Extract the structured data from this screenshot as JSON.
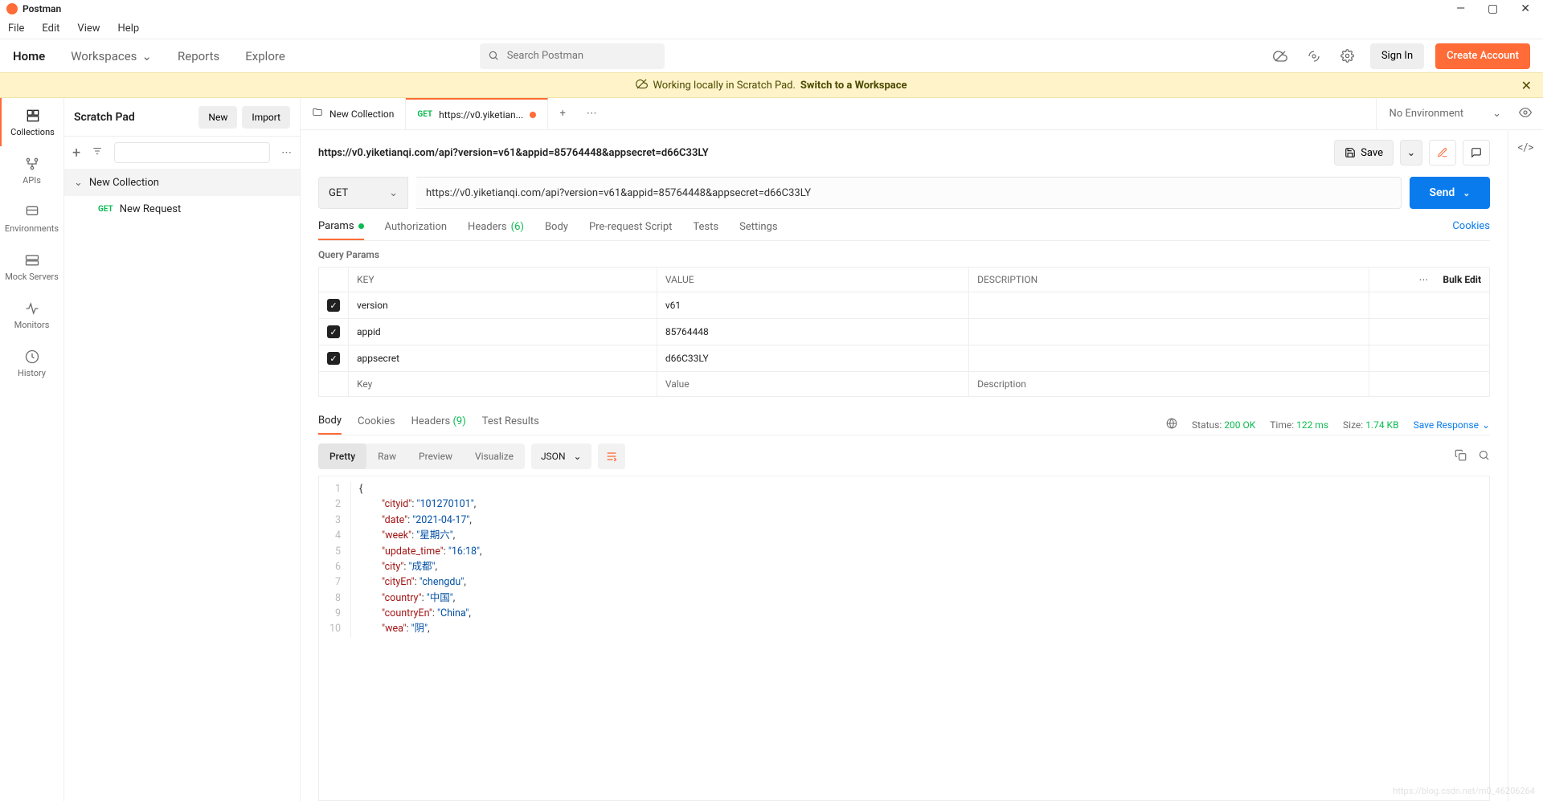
{
  "window": {
    "title": "Postman"
  },
  "menubar": [
    "File",
    "Edit",
    "View",
    "Help"
  ],
  "topnav": {
    "home": "Home",
    "workspaces": "Workspaces",
    "reports": "Reports",
    "explore": "Explore"
  },
  "search": {
    "placeholder": "Search Postman"
  },
  "auth": {
    "sign_in": "Sign In",
    "create": "Create Account"
  },
  "banner": {
    "text": "Working locally in Scratch Pad.",
    "link": "Switch to a Workspace"
  },
  "rail": [
    {
      "label": "Collections"
    },
    {
      "label": "APIs"
    },
    {
      "label": "Environments"
    },
    {
      "label": "Mock Servers"
    },
    {
      "label": "Monitors"
    },
    {
      "label": "History"
    }
  ],
  "sidebar": {
    "title": "Scratch Pad",
    "new": "New",
    "import": "Import",
    "collection": "New Collection",
    "request": {
      "method": "GET",
      "name": "New Request"
    }
  },
  "tabs": {
    "t0": {
      "label": "New Collection"
    },
    "t1": {
      "method": "GET",
      "label": "https://v0.yiketian..."
    },
    "env": "No Environment"
  },
  "request": {
    "title": "https://v0.yiketianqi.com/api?version=v61&appid=85764448&appsecret=d66C33LY",
    "method": "GET",
    "url": "https://v0.yiketianqi.com/api?version=v61&appid=85764448&appsecret=d66C33LY",
    "save": "Save",
    "send": "Send",
    "tabs": {
      "params": "Params",
      "auth": "Authorization",
      "headers": "Headers",
      "headers_count": "(6)",
      "body": "Body",
      "pre": "Pre-request Script",
      "tests": "Tests",
      "settings": "Settings",
      "cookies": "Cookies"
    },
    "qp_label": "Query Params",
    "table": {
      "th_key": "KEY",
      "th_val": "VALUE",
      "th_desc": "DESCRIPTION",
      "bulk": "Bulk Edit",
      "rows": [
        {
          "key": "version",
          "value": "v61"
        },
        {
          "key": "appid",
          "value": "85764448"
        },
        {
          "key": "appsecret",
          "value": "d66C33LY"
        }
      ],
      "ph_key": "Key",
      "ph_value": "Value",
      "ph_desc": "Description"
    }
  },
  "response": {
    "tabs": {
      "body": "Body",
      "cookies": "Cookies",
      "headers": "Headers",
      "headers_count": "(9)",
      "tests": "Test Results"
    },
    "meta": {
      "status_lbl": "Status:",
      "status_val": "200 OK",
      "time_lbl": "Time:",
      "time_val": "122 ms",
      "size_lbl": "Size:",
      "size_val": "1.74 KB"
    },
    "save": "Save Response",
    "views": {
      "pretty": "Pretty",
      "raw": "Raw",
      "preview": "Preview",
      "visualize": "Visualize"
    },
    "format": "JSON",
    "body_lines": [
      [
        {
          "t": "punc",
          "v": "{"
        }
      ],
      [
        {
          "t": "indent"
        },
        {
          "t": "key",
          "v": "\"cityid\""
        },
        {
          "t": "punc",
          "v": ": "
        },
        {
          "t": "str",
          "v": "\"101270101\""
        },
        {
          "t": "punc",
          "v": ","
        }
      ],
      [
        {
          "t": "indent"
        },
        {
          "t": "key",
          "v": "\"date\""
        },
        {
          "t": "punc",
          "v": ": "
        },
        {
          "t": "str",
          "v": "\"2021-04-17\""
        },
        {
          "t": "punc",
          "v": ","
        }
      ],
      [
        {
          "t": "indent"
        },
        {
          "t": "key",
          "v": "\"week\""
        },
        {
          "t": "punc",
          "v": ": "
        },
        {
          "t": "str",
          "v": "\"星期六\""
        },
        {
          "t": "punc",
          "v": ","
        }
      ],
      [
        {
          "t": "indent"
        },
        {
          "t": "key",
          "v": "\"update_time\""
        },
        {
          "t": "punc",
          "v": ": "
        },
        {
          "t": "str",
          "v": "\"16:18\""
        },
        {
          "t": "punc",
          "v": ","
        }
      ],
      [
        {
          "t": "indent"
        },
        {
          "t": "key",
          "v": "\"city\""
        },
        {
          "t": "punc",
          "v": ": "
        },
        {
          "t": "str",
          "v": "\"成都\""
        },
        {
          "t": "punc",
          "v": ","
        }
      ],
      [
        {
          "t": "indent"
        },
        {
          "t": "key",
          "v": "\"cityEn\""
        },
        {
          "t": "punc",
          "v": ": "
        },
        {
          "t": "str",
          "v": "\"chengdu\""
        },
        {
          "t": "punc",
          "v": ","
        }
      ],
      [
        {
          "t": "indent"
        },
        {
          "t": "key",
          "v": "\"country\""
        },
        {
          "t": "punc",
          "v": ": "
        },
        {
          "t": "str",
          "v": "\"中国\""
        },
        {
          "t": "punc",
          "v": ","
        }
      ],
      [
        {
          "t": "indent"
        },
        {
          "t": "key",
          "v": "\"countryEn\""
        },
        {
          "t": "punc",
          "v": ": "
        },
        {
          "t": "str",
          "v": "\"China\""
        },
        {
          "t": "punc",
          "v": ","
        }
      ],
      [
        {
          "t": "indent"
        },
        {
          "t": "key",
          "v": "\"wea\""
        },
        {
          "t": "punc",
          "v": ": "
        },
        {
          "t": "str",
          "v": "\"阴\""
        },
        {
          "t": "punc",
          "v": ","
        }
      ]
    ]
  },
  "watermark": "https://blog.csdn.net/m0_46206264"
}
